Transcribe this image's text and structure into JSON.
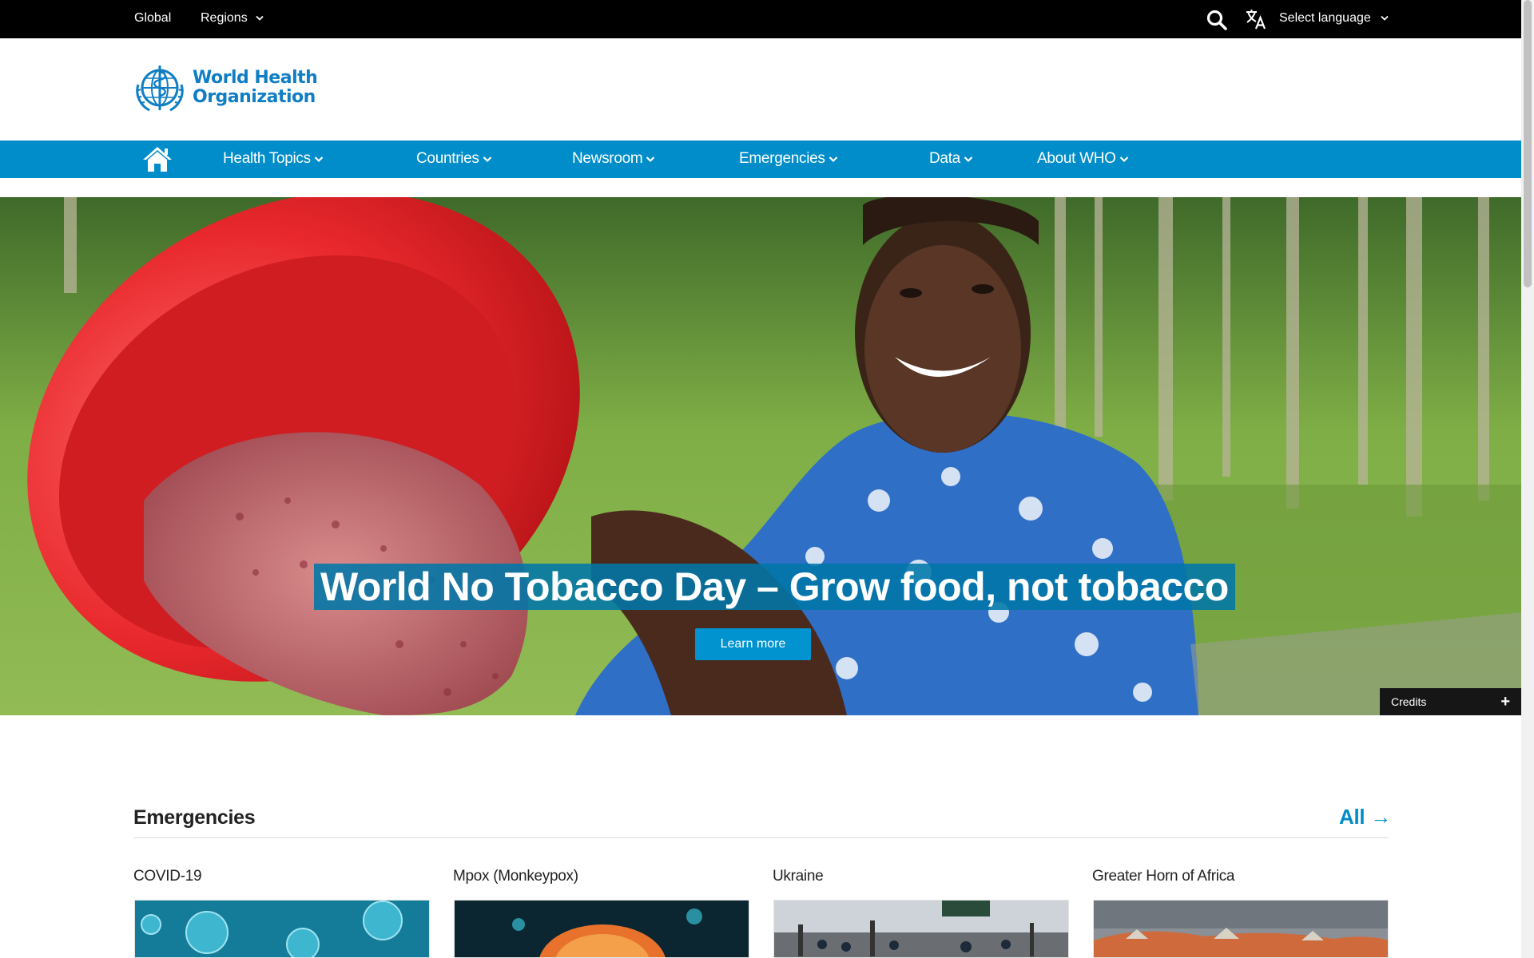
{
  "topbar": {
    "global": "Global",
    "regions": "Regions",
    "language": "Select language"
  },
  "logo": {
    "line1": "World Health",
    "line2": "Organization"
  },
  "nav": {
    "items": [
      "Health Topics",
      "Countries",
      "Newsroom",
      "Emergencies",
      "Data",
      "About WHO"
    ]
  },
  "hero": {
    "title": "World No Tobacco Day – Grow food, not tobacco",
    "button": "Learn more",
    "credits": "Credits",
    "credits_toggle": "+"
  },
  "emergencies": {
    "title": "Emergencies",
    "all_link": "All →",
    "cards": [
      "COVID-19",
      "Mpox (Monkeypox)",
      "Ukraine",
      "Greater Horn of Africa"
    ]
  },
  "colors": {
    "brand_blue": "#008dc9",
    "logo_blue": "#0f7ec4",
    "topbar": "#000000"
  },
  "icons": [
    "search-icon",
    "translate-icon",
    "chevron-down-icon",
    "home-icon",
    "who-emblem-icon",
    "plus-icon"
  ]
}
